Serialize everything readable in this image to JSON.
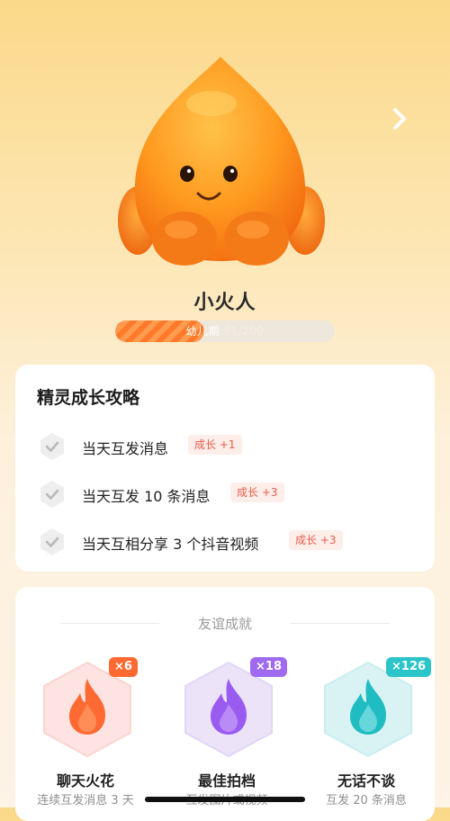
{
  "pet": {
    "name": "小火人",
    "stage": "幼儿期",
    "progress_text": "81/200",
    "progress_fraction": 0.405
  },
  "guide": {
    "title": "精灵成长攻略",
    "tasks": [
      {
        "text": "当天互发消息",
        "badge": "成长 +1"
      },
      {
        "text": "当天互发 10 条消息",
        "badge": "成长 +3"
      },
      {
        "text": "当天互相分享 3 个抖音视频",
        "badge": "成长 +3"
      }
    ]
  },
  "achievements": {
    "title": "友谊成就",
    "items": [
      {
        "name": "聊天火花",
        "desc": "连续互发消息 3 天",
        "count": "×6",
        "color": "#ff6a33"
      },
      {
        "name": "最佳拍档",
        "desc": "互发图片或视频",
        "count": "×18",
        "color": "#a06af0"
      },
      {
        "name": "无话不谈",
        "desc": "互发 20 条消息",
        "count": "×126",
        "color": "#2bc4c9"
      }
    ]
  },
  "icons": {
    "next": "chevron-right-icon",
    "check": "check-icon",
    "flame": "flame-icon"
  }
}
